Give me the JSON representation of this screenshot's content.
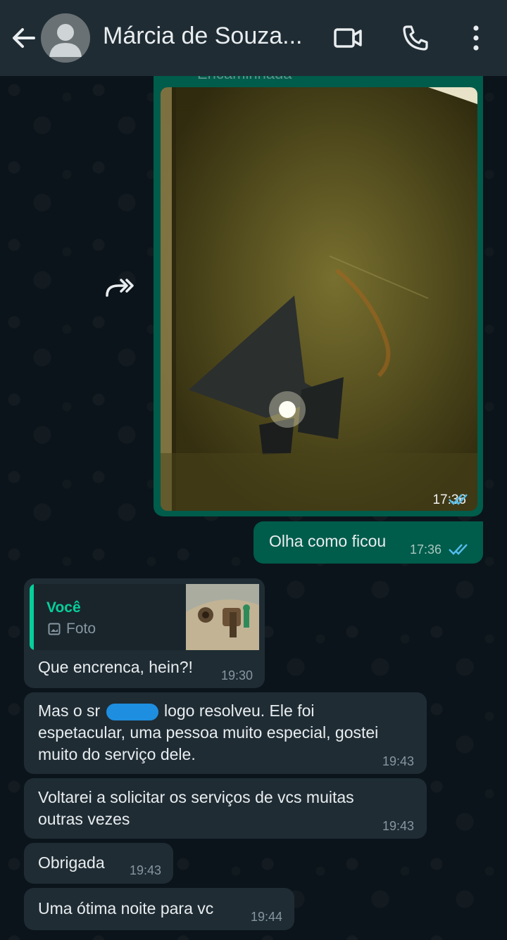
{
  "header": {
    "contact_name": "Márcia de Souza..."
  },
  "messages": {
    "forwarded": {
      "label": "Encaminhada",
      "time": "17:36"
    },
    "out_text": {
      "text": "Olha como ficou",
      "time": "17:36"
    },
    "reply": {
      "quote_author": "Você",
      "quote_type": "Foto",
      "text": "Que encrenca, hein?!",
      "time": "19:30"
    },
    "msg1": {
      "line1": "Mas o sr ",
      "line1b": " logo resolveu. Ele foi",
      "line2": "espetacular, uma pessoa muito especial, gostei",
      "line3": "muito do serviço dele.",
      "time": "19:43"
    },
    "msg2": {
      "line1": "Voltarei a solicitar os serviços de vcs muitas",
      "line2": "outras vezes",
      "time": "19:43"
    },
    "msg3": {
      "text": "Obrigada",
      "time": "19:43"
    },
    "msg4": {
      "text": "Uma ótima noite para vc",
      "time": "19:44"
    }
  },
  "colors": {
    "header_bg": "#1f2c34",
    "chat_bg": "#0b141a",
    "outgoing_bubble": "#005c4b",
    "incoming_bubble": "#1f2c34",
    "read_ticks": "#53bdeb",
    "quote_accent": "#06cf9c"
  },
  "icons": [
    "back-arrow-icon",
    "avatar-icon",
    "video-call-icon",
    "phone-icon",
    "more-vert-icon",
    "forward-icon",
    "read-ticks-icon",
    "photo-icon"
  ]
}
